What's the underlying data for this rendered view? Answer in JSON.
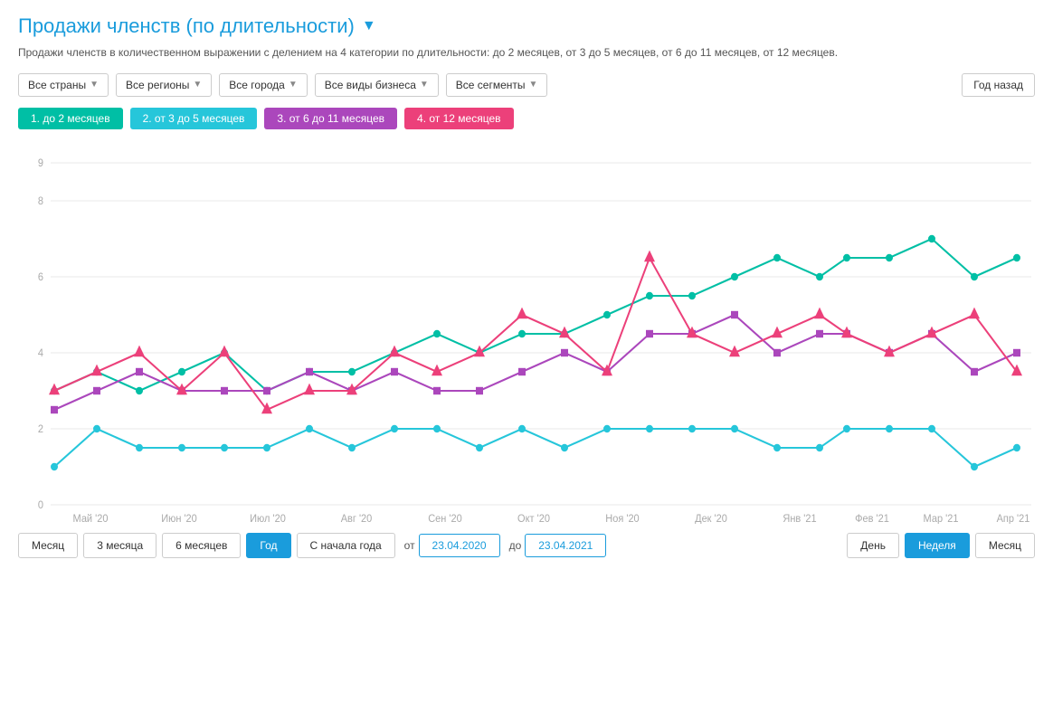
{
  "header": {
    "title": "Продажи членств (по длительности)",
    "subtitle": "Продажи членств в количественном выражении с делением на 4 категории по длительности: до 2 месяцев, от 3 до 5 месяцев, от 6 до 11 месяцев, от 12 месяцев."
  },
  "filters": [
    {
      "label": "Все страны",
      "id": "countries"
    },
    {
      "label": "Все регионы",
      "id": "regions"
    },
    {
      "label": "Все города",
      "id": "cities"
    },
    {
      "label": "Все виды бизнеса",
      "id": "business"
    },
    {
      "label": "Все сегменты",
      "id": "segments"
    }
  ],
  "period_btn": "Год назад",
  "legend": [
    {
      "label": "1. до 2 месяцев",
      "color": "#00bfa5"
    },
    {
      "label": "2. от 3 до 5 месяцев",
      "color": "#26c6da"
    },
    {
      "label": "3. от 6 до 11 месяцев",
      "color": "#ab47bc"
    },
    {
      "label": "4. от 12 месяцев",
      "color": "#ec407a"
    }
  ],
  "x_labels": [
    "Май '20",
    "Июн '20",
    "Июл '20",
    "Авг '20",
    "Сен '20",
    "Окт '20",
    "Ноя '20",
    "Дек '20",
    "Янв '21",
    "Фев '21",
    "Мар '21",
    "Апр '21"
  ],
  "y_labels": [
    "0",
    "2",
    "4",
    "6",
    "8",
    "9"
  ],
  "bottom_controls": {
    "period_btns": [
      {
        "label": "Месяц",
        "active": false
      },
      {
        "label": "3 месяца",
        "active": false
      },
      {
        "label": "6 месяцев",
        "active": false
      },
      {
        "label": "Год",
        "active": true
      },
      {
        "label": "С начала года",
        "active": false
      }
    ],
    "from_label": "от",
    "to_label": "до",
    "from_date": "23.04.2020",
    "to_date": "23.04.2021",
    "right_btns": [
      {
        "label": "День",
        "active": false
      },
      {
        "label": "Неделя",
        "active": true
      },
      {
        "label": "Месяц",
        "active": false
      }
    ]
  }
}
